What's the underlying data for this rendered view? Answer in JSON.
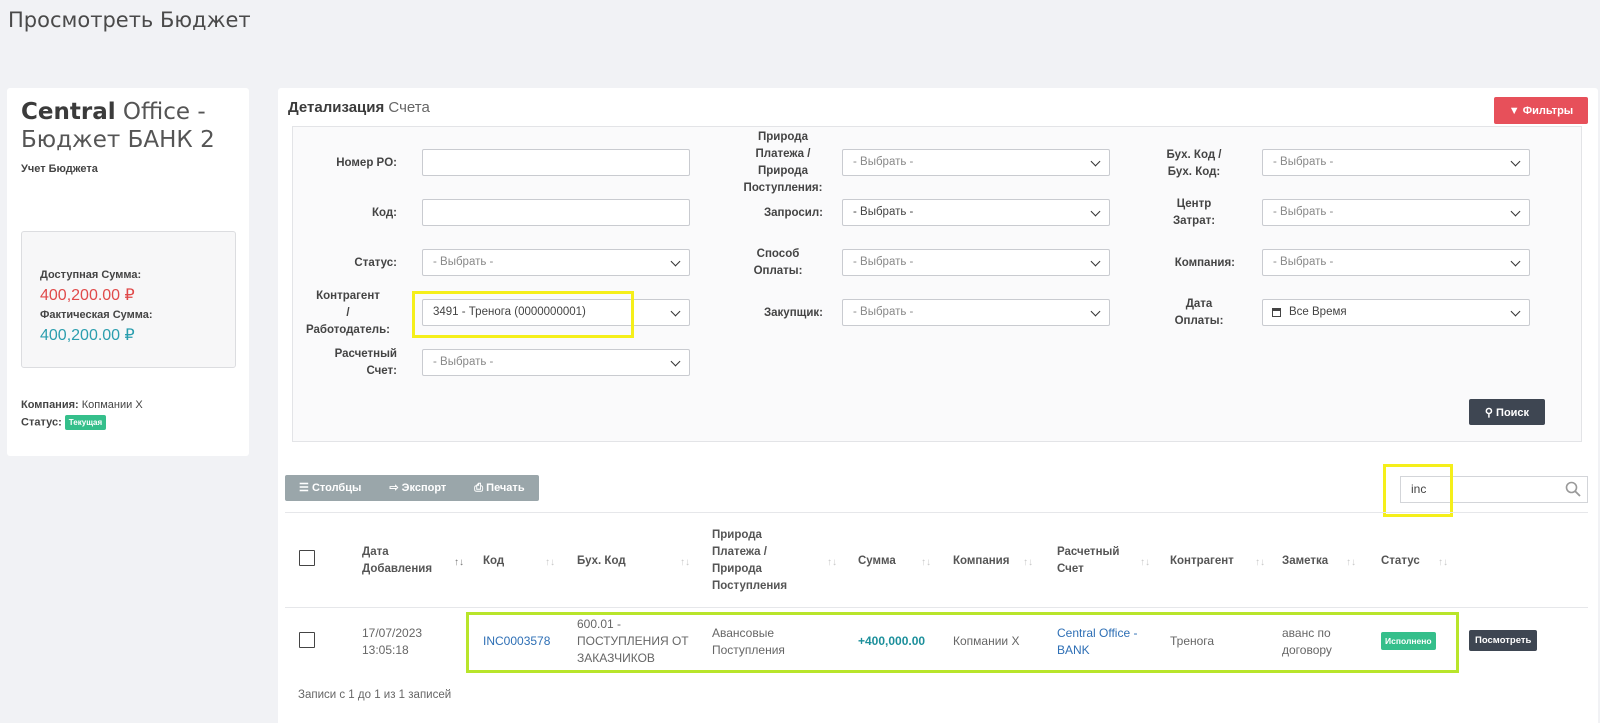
{
  "page": {
    "title": "Просмотреть Бюджет"
  },
  "sidebar": {
    "title_bold": "Central",
    "title_rest": "Office - Бюджет БАНК 2",
    "subtitle": "Учет Бюджета",
    "available_label": "Доступная Сумма:",
    "available_value": "400,200.00 ₽",
    "actual_label": "Фактическая Сумма:",
    "actual_value": "400,200.00 ₽",
    "company_label": "Компания:",
    "company_value": "Копмании X",
    "status_label": "Статус:",
    "status_badge": "Текущая",
    "colors": {
      "available": "#e04a4a",
      "actual": "#2b9eae",
      "badge": "#35bf8b"
    }
  },
  "main": {
    "title_bold": "Детализация",
    "title_rest": "Счета",
    "filters_button": "Фильтры",
    "search_button": "Поиск",
    "filters": {
      "po_number": {
        "label": "Номер PO:",
        "value": ""
      },
      "code": {
        "label": "Код:",
        "value": ""
      },
      "status": {
        "label": "Статус:",
        "value": "- Выбрать -"
      },
      "counterparty": {
        "label_1": "Контрагент",
        "label_2": "/",
        "label_3": "Работодатель:",
        "value": "3491 - Тренога (0000000001)"
      },
      "account": {
        "label_1": "Расчетный",
        "label_2": "Счет:",
        "value": "- Выбрать -"
      },
      "nature": {
        "label_1": "Природа",
        "label_2": "Платежа /",
        "label_3": "Природа",
        "label_4": "Поступления:",
        "value": "- Выбрать -"
      },
      "requested": {
        "label": "Запросил:",
        "value": "- Выбрать -"
      },
      "payment_method": {
        "label_1": "Способ",
        "label_2": "Оплаты:",
        "value": "- Выбрать -"
      },
      "buyer": {
        "label": "Закупщик:",
        "value": "- Выбрать -"
      },
      "acc_code": {
        "label_1": "Бух. Код /",
        "label_2": "Бух. Код:",
        "value": "- Выбрать -"
      },
      "cost_center": {
        "label_1": "Центр",
        "label_2": "Затрат:",
        "value": "- Выбрать -"
      },
      "company": {
        "label": "Компания:",
        "value": "- Выбрать -"
      },
      "payment_date": {
        "label_1": "Дата",
        "label_2": "Оплаты:",
        "value": "Все Время"
      }
    },
    "toolbar": {
      "columns": "Столбцы",
      "export": "Экспорт",
      "print": "Печать"
    },
    "search": {
      "value": "inc"
    },
    "table": {
      "headers": {
        "date_1": "Дата",
        "date_2": "Добавления",
        "code": "Код",
        "acc_code": "Бух. Код",
        "nature_1": "Природа",
        "nature_2": "Платежа /",
        "nature_3": "Природа",
        "nature_4": "Поступления",
        "amount": "Сумма",
        "company": "Компания",
        "account_1": "Расчетный",
        "account_2": "Счет",
        "counterparty": "Контрагент",
        "note": "Заметка",
        "status": "Статус"
      },
      "rows": [
        {
          "date_1": "17/07/2023",
          "date_2": "13:05:18",
          "code": "INC0003578",
          "acc_code_1": "600.01 -",
          "acc_code_2": "ПОСТУПЛЕНИЯ ОТ",
          "acc_code_3": "ЗАКАЗЧИКОВ",
          "nature_1": "Авансовые",
          "nature_2": "Поступления",
          "amount": "+400,000.00",
          "company": "Копмании X",
          "account_1": "Central Office -",
          "account_2": "BANK",
          "counterparty": "Тренога",
          "note_1": "аванс по",
          "note_2": "договору",
          "status": "Исполнено",
          "action": "Посмотреть"
        }
      ]
    },
    "records_info": "Записи с 1 до 1 из 1 записей",
    "colors": {
      "filters_button": "#e7505a",
      "dark_button": "#3e4652",
      "highlight_yellow": "#f5ef1a",
      "highlight_green": "#b8e52a"
    }
  }
}
